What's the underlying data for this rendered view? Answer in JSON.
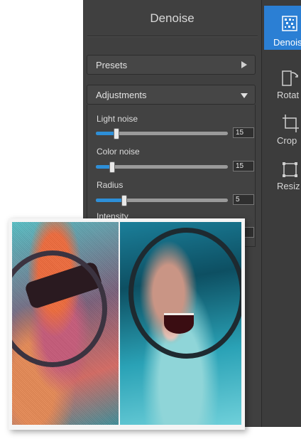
{
  "panel": {
    "title": "Denoise",
    "presets_label": "Presets",
    "adjustments_label": "Adjustments",
    "sliders": [
      {
        "label": "Light noise",
        "value": "15",
        "fraction": 0.15
      },
      {
        "label": "Color noise",
        "value": "15",
        "fraction": 0.12
      },
      {
        "label": "Radius",
        "value": "5",
        "fraction": 0.21
      },
      {
        "label": "Intensity",
        "value": "",
        "fraction": 0.0
      }
    ]
  },
  "toolbar": {
    "tools": [
      {
        "label": "Denoise",
        "icon": "denoise-icon",
        "active": true
      },
      {
        "label": "Rotat",
        "icon": "rotate-icon",
        "active": false
      },
      {
        "label": "Crop",
        "icon": "crop-icon",
        "active": false
      },
      {
        "label": "Resiz",
        "icon": "resize-icon",
        "active": false
      }
    ]
  },
  "colors": {
    "accent": "#2b7fd4",
    "panel_bg": "#404040",
    "slider_fill": "#2d8fd8"
  }
}
